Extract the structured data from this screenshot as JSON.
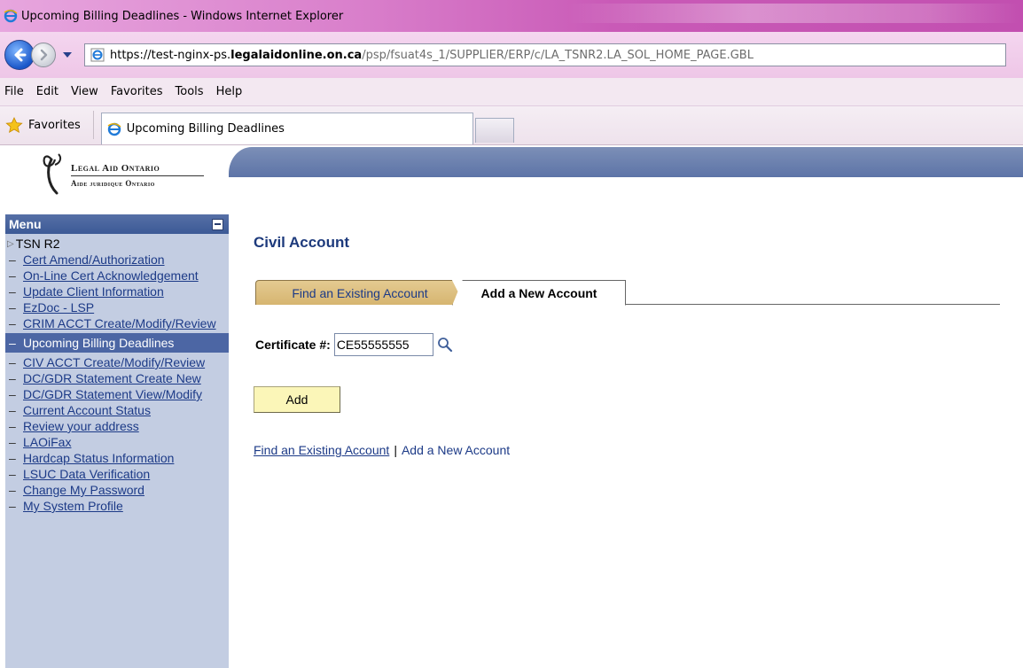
{
  "window": {
    "title": "Upcoming Billing Deadlines - Windows Internet Explorer"
  },
  "address": {
    "url_base": "https://test-nginx-ps.",
    "url_domain": "legalaidonline.on.ca",
    "url_path": "/psp/fsuat4s_1/SUPPLIER/ERP/c/LA_TSNR2.LA_SOL_HOME_PAGE.GBL"
  },
  "menubar": {
    "items": [
      "File",
      "Edit",
      "View",
      "Favorites",
      "Tools",
      "Help"
    ]
  },
  "favorites": {
    "label": "Favorites",
    "tab_title": "Upcoming Billing Deadlines"
  },
  "logo": {
    "english": "Legal Aid Ontario",
    "french": "Aide juridique Ontario"
  },
  "menu": {
    "header": "Menu",
    "root": "TSN R2",
    "items": [
      {
        "label": "Cert Amend/Authorization",
        "active": false
      },
      {
        "label": "On-Line Cert Acknowledgement",
        "active": false
      },
      {
        "label": "Update Client Information",
        "active": false
      },
      {
        "label": "EzDoc - LSP",
        "active": false
      },
      {
        "label": "CRIM ACCT Create/Modify/Review",
        "active": false
      },
      {
        "label": "Upcoming Billing Deadlines",
        "active": true
      },
      {
        "label": "CIV ACCT Create/Modify/Review",
        "active": false
      },
      {
        "label": "DC/GDR Statement Create New",
        "active": false
      },
      {
        "label": "DC/GDR Statement View/Modify",
        "active": false
      },
      {
        "label": "Current Account Status",
        "active": false
      },
      {
        "label": "Review your address",
        "active": false
      },
      {
        "label": "LAOiFax",
        "active": false
      },
      {
        "label": "Hardcap Status Information",
        "active": false
      },
      {
        "label": "LSUC Data Verification",
        "active": false
      },
      {
        "label": "Change My Password",
        "active": false
      },
      {
        "label": "My System Profile",
        "active": false
      }
    ]
  },
  "main": {
    "title": "Civil Account",
    "tabs": [
      {
        "label": "Find an Existing Account",
        "active": false
      },
      {
        "label": "Add a New Account",
        "active": true
      }
    ],
    "certificate_label": "Certificate #:",
    "certificate_value": "CE55555555",
    "add_button": "Add",
    "links": {
      "find": "Find an Existing Account",
      "separator": "|",
      "add": "Add a New Account"
    }
  },
  "colors": {
    "titlebar": "#c95ab7",
    "header_band": "#5d74a7",
    "menu_bg": "#c3cde2",
    "menu_active": "#4c66a4",
    "title_text": "#1d3a7c",
    "link": "#1c3a87",
    "add_button_bg": "#fbf6b8",
    "inactive_tab": "#d6b570"
  },
  "icons": {
    "back": "back-arrow-icon",
    "forward": "forward-arrow-icon",
    "browser": "internet-explorer-icon",
    "favorites": "star-icon",
    "lookup": "magnifier-icon",
    "collapse": "minus-icon",
    "expand": "triangle-right-icon"
  }
}
